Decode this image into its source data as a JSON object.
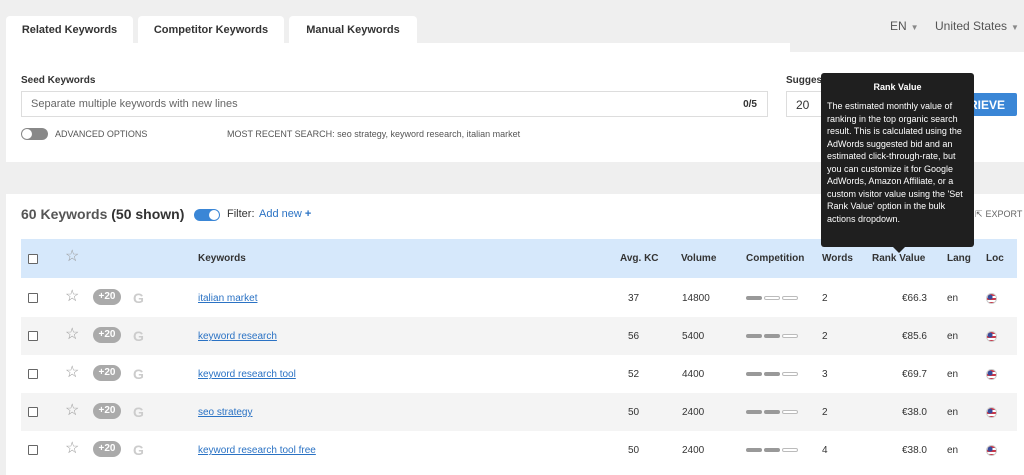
{
  "tabs": [
    {
      "label": "Related Keywords"
    },
    {
      "label": "Competitor Keywords"
    },
    {
      "label": "Manual Keywords"
    }
  ],
  "locale": {
    "language": "EN",
    "country": "United States"
  },
  "seed": {
    "label": "Seed Keywords",
    "placeholder": "Separate multiple keywords with new lines",
    "count": "0/5"
  },
  "suggestions": {
    "label": "Suggestions per keyword",
    "value": "20"
  },
  "retrieve_label": "RETRIEVE",
  "advanced_options": "ADVANCED OPTIONS",
  "recent_search": "MOST RECENT SEARCH: seo strategy, keyword research, italian market",
  "results": {
    "title": "60 Keywords",
    "shown": "(50 shown)",
    "filter_label": "Filter:",
    "add_new": "Add new",
    "export": "EXPORT"
  },
  "columns": {
    "keywords": "Keywords",
    "avg_kc": "Avg. KC",
    "volume": "Volume",
    "competition": "Competition",
    "words": "Words",
    "rank_value": "Rank Value",
    "lang": "Lang",
    "loc": "Loc"
  },
  "rows": [
    {
      "plus": "+20",
      "keyword": "italian market",
      "kc": "37",
      "volume": "14800",
      "competition_level": 1,
      "words": "2",
      "rank": "€66.3",
      "lang": "en"
    },
    {
      "plus": "+20",
      "keyword": "keyword research",
      "kc": "56",
      "volume": "5400",
      "competition_level": 2,
      "words": "2",
      "rank": "€85.6",
      "lang": "en"
    },
    {
      "plus": "+20",
      "keyword": "keyword research tool",
      "kc": "52",
      "volume": "4400",
      "competition_level": 2,
      "words": "3",
      "rank": "€69.7",
      "lang": "en"
    },
    {
      "plus": "+20",
      "keyword": "seo strategy",
      "kc": "50",
      "volume": "2400",
      "competition_level": 2,
      "words": "2",
      "rank": "€38.0",
      "lang": "en"
    },
    {
      "plus": "+20",
      "keyword": "keyword research tool free",
      "kc": "50",
      "volume": "2400",
      "competition_level": 2,
      "words": "4",
      "rank": "€38.0",
      "lang": "en"
    }
  ],
  "tooltip": {
    "title": "Rank Value",
    "body": "The estimated monthly value of ranking in the top organic search result. This is calculated using the AdWords suggested bid and an estimated click-through-rate, but you can customize it for Google AdWords, Amazon Affiliate, or a custom visitor value using the 'Set Rank Value' option in the bulk actions dropdown."
  },
  "colors": {
    "accent": "#3a86d6",
    "header_bg": "#d6e8fb",
    "tooltip_bg": "#1f1f1f"
  },
  "icons": {
    "star": "star-icon",
    "google": "google-icon",
    "flag": "us-flag-icon",
    "export": "export-icon"
  }
}
